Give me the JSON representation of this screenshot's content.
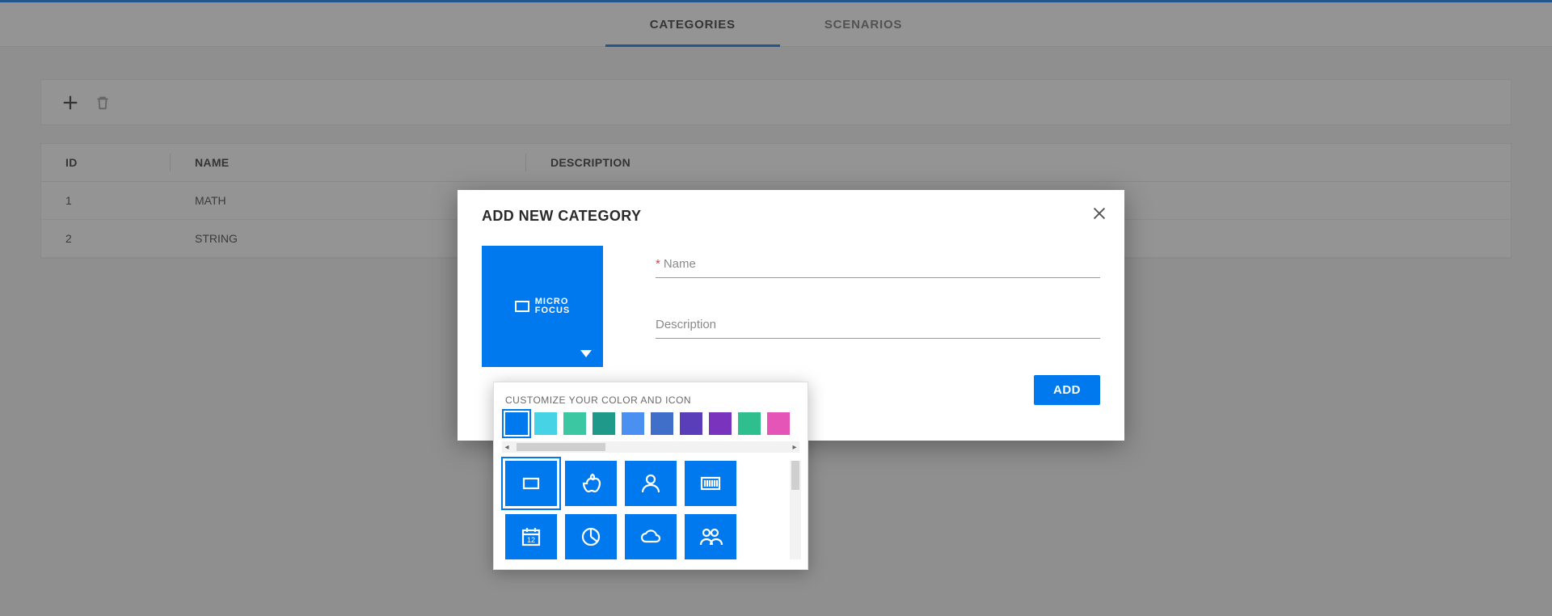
{
  "tabs": {
    "categories": "CATEGORIES",
    "scenarios": "SCENARIOS"
  },
  "toolbar": {
    "add": "add",
    "delete": "delete"
  },
  "table": {
    "headers": {
      "id": "ID",
      "name": "NAME",
      "description": "DESCRIPTION"
    },
    "rows": [
      {
        "id": "1",
        "name": "MATH",
        "description": ""
      },
      {
        "id": "2",
        "name": "STRING",
        "description": ""
      }
    ]
  },
  "dialog": {
    "title": "ADD NEW CATEGORY",
    "name_label": "Name",
    "description_label": "Description",
    "name_value": "",
    "description_value": "",
    "add_button": "ADD",
    "preview_logo_line1": "MICRO",
    "preview_logo_line2": "FOCUS"
  },
  "popover": {
    "title": "CUSTOMIZE YOUR COLOR AND ICON",
    "colors": [
      "#0079ef",
      "#45d3e5",
      "#3cc7a3",
      "#1f9a8a",
      "#4a90f0",
      "#3f6fc9",
      "#5a3db8",
      "#7a33bd",
      "#2fbf8f",
      "#e555b7"
    ],
    "selected_color_index": 0,
    "icons": [
      "microfocus",
      "apple",
      "person",
      "barcode",
      "calendar",
      "pie",
      "cloud",
      "people"
    ],
    "selected_icon_index": 0
  }
}
